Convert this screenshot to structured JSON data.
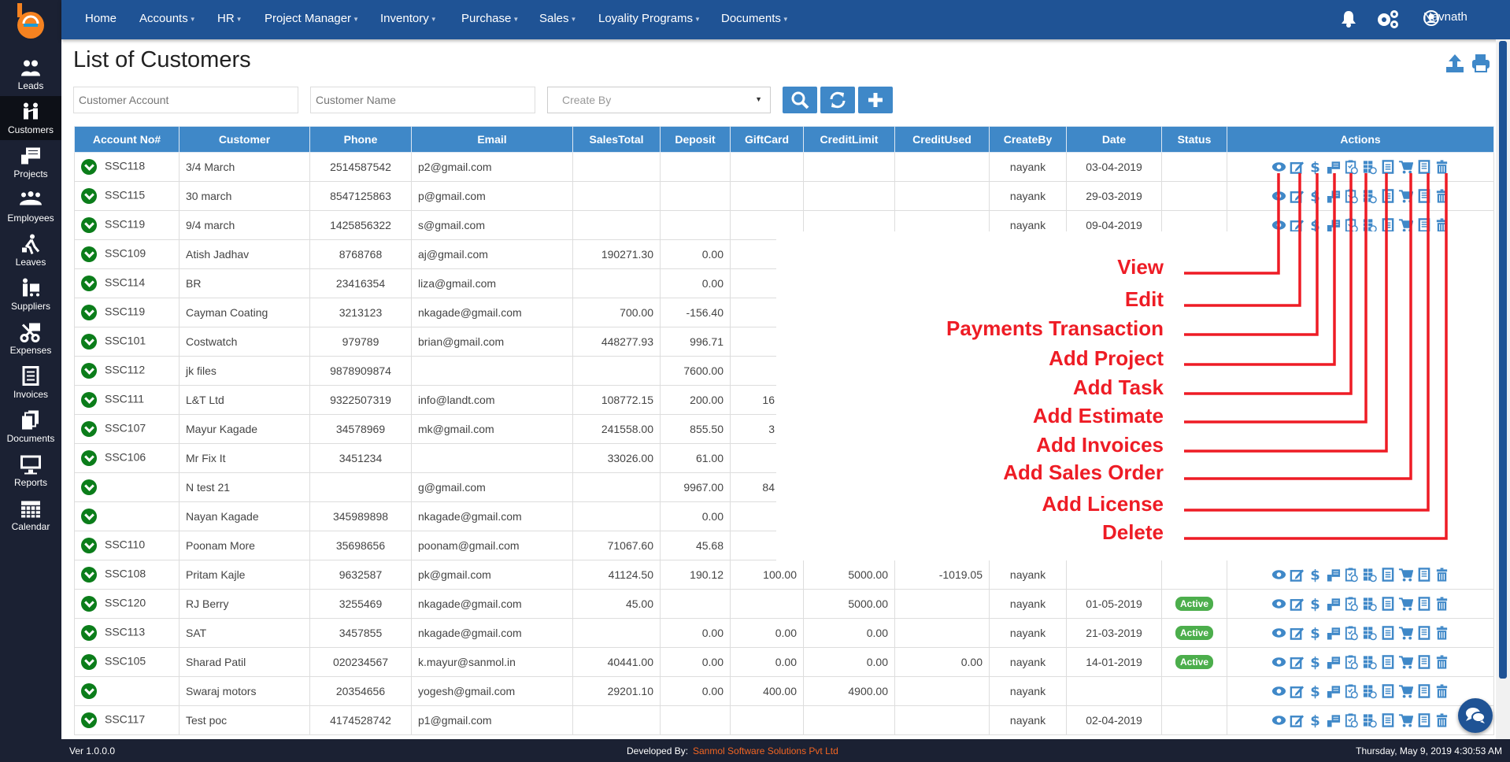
{
  "sidebar": {
    "items": [
      {
        "label": "Leads",
        "icon": "leads-icon"
      },
      {
        "label": "Customers",
        "icon": "customers-icon",
        "active": true
      },
      {
        "label": "Projects",
        "icon": "projects-icon"
      },
      {
        "label": "Employees",
        "icon": "employees-icon"
      },
      {
        "label": "Leaves",
        "icon": "leaves-icon"
      },
      {
        "label": "Suppliers",
        "icon": "suppliers-icon"
      },
      {
        "label": "Expenses",
        "icon": "expenses-icon"
      },
      {
        "label": "Invoices",
        "icon": "invoices-icon"
      },
      {
        "label": "Documents",
        "icon": "documents-icon"
      },
      {
        "label": "Reports",
        "icon": "reports-icon"
      },
      {
        "label": "Calendar",
        "icon": "calendar-icon"
      }
    ]
  },
  "nav": {
    "items": [
      {
        "label": "Home",
        "dropdown": false
      },
      {
        "label": "Accounts",
        "dropdown": true
      },
      {
        "label": "HR",
        "dropdown": true
      },
      {
        "label": "Project Manager",
        "dropdown": true
      },
      {
        "label": "Inventory",
        "dropdown": true
      },
      {
        "label": "Purchase",
        "dropdown": true
      },
      {
        "label": "Sales",
        "dropdown": true
      },
      {
        "label": "Loyality Programs",
        "dropdown": true
      },
      {
        "label": "Documents",
        "dropdown": true
      }
    ],
    "user": "Navnath"
  },
  "page": {
    "title": "List of Customers"
  },
  "filters": {
    "account_placeholder": "Customer Account",
    "name_placeholder": "Customer Name",
    "createby_value": "Create By"
  },
  "table": {
    "columns": [
      "Account No#",
      "Customer",
      "Phone",
      "Email",
      "SalesTotal",
      "Deposit",
      "GiftCard",
      "CreditLimit",
      "CreditUsed",
      "CreateBy",
      "Date",
      "Status",
      "Actions"
    ],
    "rows": [
      [
        "SSC118",
        "3/4 March",
        "2514587542",
        "p2@gmail.com",
        "",
        "",
        "",
        "",
        "",
        "nayank",
        "03-04-2019",
        ""
      ],
      [
        "SSC115",
        "30 march",
        "8547125863",
        "p@gmail.com",
        "",
        "",
        "",
        "",
        "",
        "nayank",
        "29-03-2019",
        ""
      ],
      [
        "SSC119",
        "9/4 march",
        "1425856322",
        "s@gmail.com",
        "",
        "",
        "",
        "",
        "",
        "nayank",
        "09-04-2019",
        ""
      ],
      [
        "SSC109",
        "Atish Jadhav",
        "8768768",
        "aj@gmail.com",
        "190271.30",
        "0.00",
        "",
        "",
        "",
        "",
        "",
        ""
      ],
      [
        "SSC114",
        "BR",
        "23416354",
        "liza@gmail.com",
        "",
        "0.00",
        "",
        "",
        "",
        "",
        "",
        ""
      ],
      [
        "SSC119",
        "Cayman Coating",
        "3213123",
        "nkagade@gmail.com",
        "700.00",
        "-156.40",
        "",
        "",
        "",
        "",
        "",
        ""
      ],
      [
        "SSC101",
        "Costwatch",
        "979789",
        "brian@gmail.com",
        "448277.93",
        "996.71",
        "",
        "",
        "",
        "",
        "",
        ""
      ],
      [
        "SSC112",
        "jk files",
        "9878909874",
        "",
        "",
        "7600.00",
        "",
        "",
        "",
        "",
        "",
        ""
      ],
      [
        "SSC111",
        "L&T Ltd",
        "9322507319",
        "info@landt.com",
        "108772.15",
        "200.00",
        "16",
        "",
        "",
        "",
        "",
        ""
      ],
      [
        "SSC107",
        "Mayur Kagade",
        "34578969",
        "mk@gmail.com",
        "241558.00",
        "855.50",
        "3",
        "",
        "",
        "",
        "",
        ""
      ],
      [
        "SSC106",
        "Mr Fix It",
        "3451234",
        "",
        "33026.00",
        "61.00",
        "",
        "",
        "",
        "",
        "",
        ""
      ],
      [
        "",
        "N test 21",
        "",
        "g@gmail.com",
        "",
        "9967.00",
        "84",
        "",
        "",
        "",
        "",
        ""
      ],
      [
        "",
        "Nayan Kagade",
        "345989898",
        "nkagade@gmail.com",
        "",
        "0.00",
        "",
        "",
        "",
        "",
        "",
        ""
      ],
      [
        "SSC110",
        "Poonam More",
        "35698656",
        "poonam@gmail.com",
        "71067.60",
        "45.68",
        "",
        "",
        "",
        "",
        "",
        ""
      ],
      [
        "SSC108",
        "Pritam Kajle",
        "9632587",
        "pk@gmail.com",
        "41124.50",
        "190.12",
        "100.00",
        "5000.00",
        "-1019.05",
        "nayank",
        "",
        ""
      ],
      [
        "SSC120",
        "RJ Berry",
        "3255469",
        "nkagade@gmail.com",
        "45.00",
        "",
        "",
        "5000.00",
        "",
        "nayank",
        "01-05-2019",
        "Active"
      ],
      [
        "SSC113",
        "SAT",
        "3457855",
        "nkagade@gmail.com",
        "",
        "0.00",
        "0.00",
        "0.00",
        "",
        "nayank",
        "21-03-2019",
        "Active"
      ],
      [
        "SSC105",
        "Sharad Patil",
        "020234567",
        "k.mayur@sanmol.in",
        "40441.00",
        "0.00",
        "0.00",
        "0.00",
        "0.00",
        "nayank",
        "14-01-2019",
        "Active"
      ],
      [
        "",
        "Swaraj motors",
        "20354656",
        "yogesh@gmail.com",
        "29201.10",
        "0.00",
        "400.00",
        "4900.00",
        "",
        "nayank",
        "",
        ""
      ],
      [
        "SSC117",
        "Test poc",
        "4174528742",
        "p1@gmail.com",
        "",
        "",
        "",
        "",
        "",
        "nayank",
        "02-04-2019",
        ""
      ]
    ],
    "action_icons": [
      "eye-icon",
      "edit-icon",
      "dollar-icon",
      "project-icon",
      "task-icon",
      "estimate-icon",
      "invoice-icon",
      "cart-icon",
      "license-icon",
      "trash-icon"
    ]
  },
  "annotations": [
    "View",
    "Edit",
    "Payments Transaction",
    "Add Project",
    "Add Task",
    "Add Estimate",
    "Add Invoices",
    "Add Sales Order",
    "Add License",
    "Delete"
  ],
  "footer": {
    "version": "Ver 1.0.0.0",
    "developed_by": "Developed By:",
    "company": "Sanmol Software Solutions Pvt Ltd",
    "datetime": "Thursday, May 9, 2019 4:30:53 AM"
  },
  "colors": {
    "nav": "#1f5395",
    "sidebar": "#1b2133",
    "header": "#3f88c8",
    "annotation": "#ee1c25",
    "active_badge": "#4cae4c",
    "company": "#f26522"
  }
}
